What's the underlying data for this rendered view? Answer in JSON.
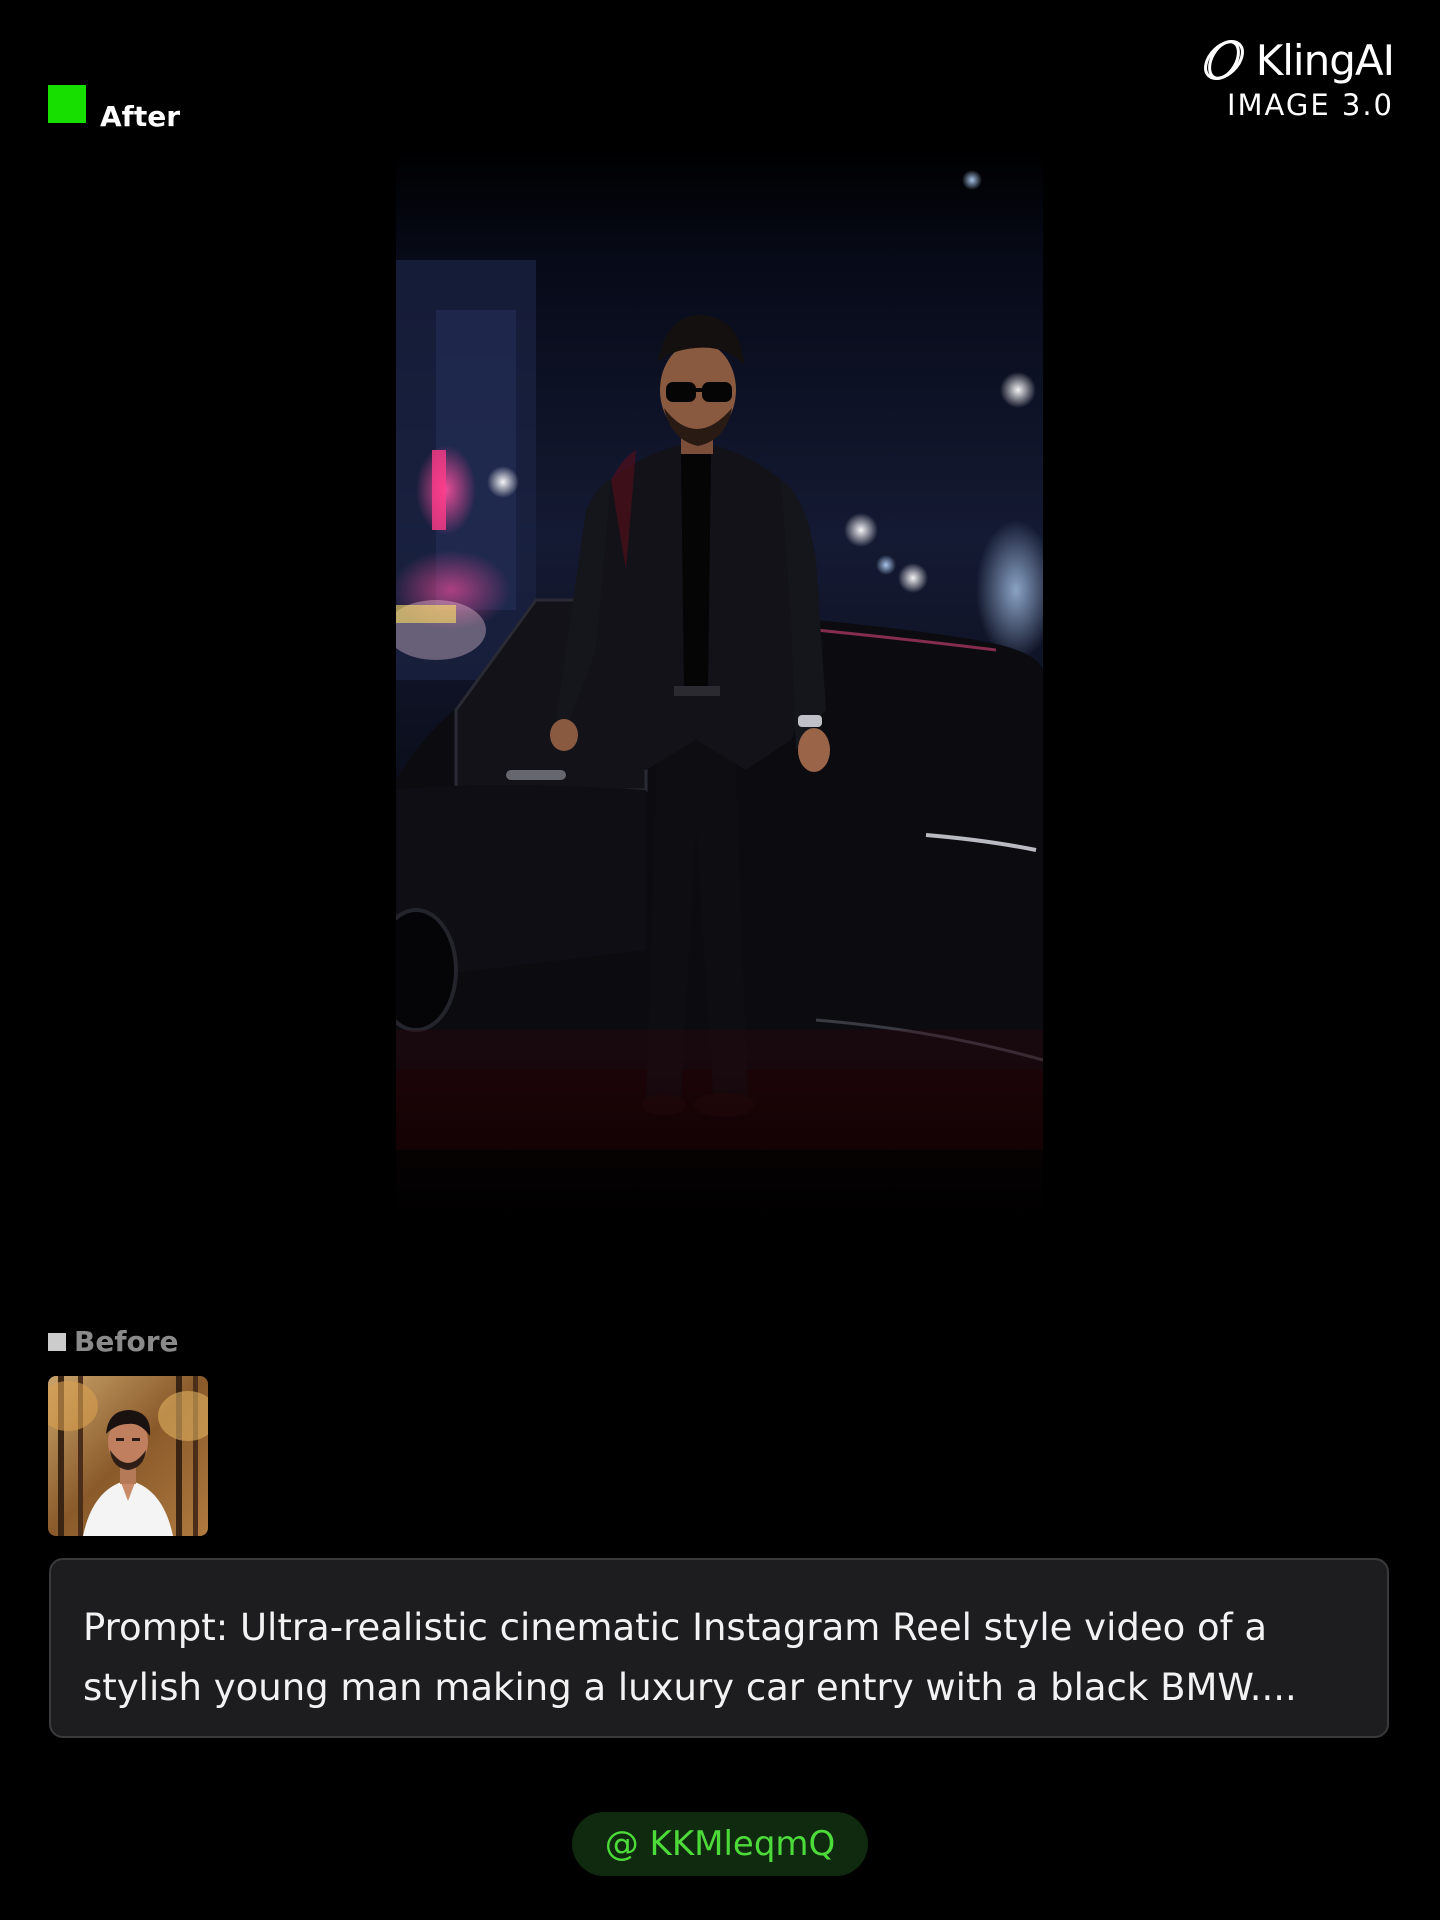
{
  "after_label": "After",
  "before_label": "Before",
  "brand": {
    "name": "KlingAI",
    "subtitle": "IMAGE 3.0",
    "logo_icon": "kling-logo-icon"
  },
  "images": {
    "main": "ai-generated-photo: young man in black suit and sunglasses stepping out of a black car at night",
    "before": "source-portrait-photo: young man in white shirt in autumn park"
  },
  "prompt": {
    "line1": "Prompt: Ultra-realistic cinematic Instagram Reel style video of a",
    "line2": "stylish young man making a luxury car entry with a black BMW...."
  },
  "handle": "@ KKMleqmQ",
  "colors": {
    "background": "#000000",
    "after_accent": "#17e000",
    "before_accent": "#cccccc",
    "prompt_bg": "#1d1d1f",
    "handle_bg": "#0f2a0f",
    "handle_text": "#4ddb3a"
  }
}
